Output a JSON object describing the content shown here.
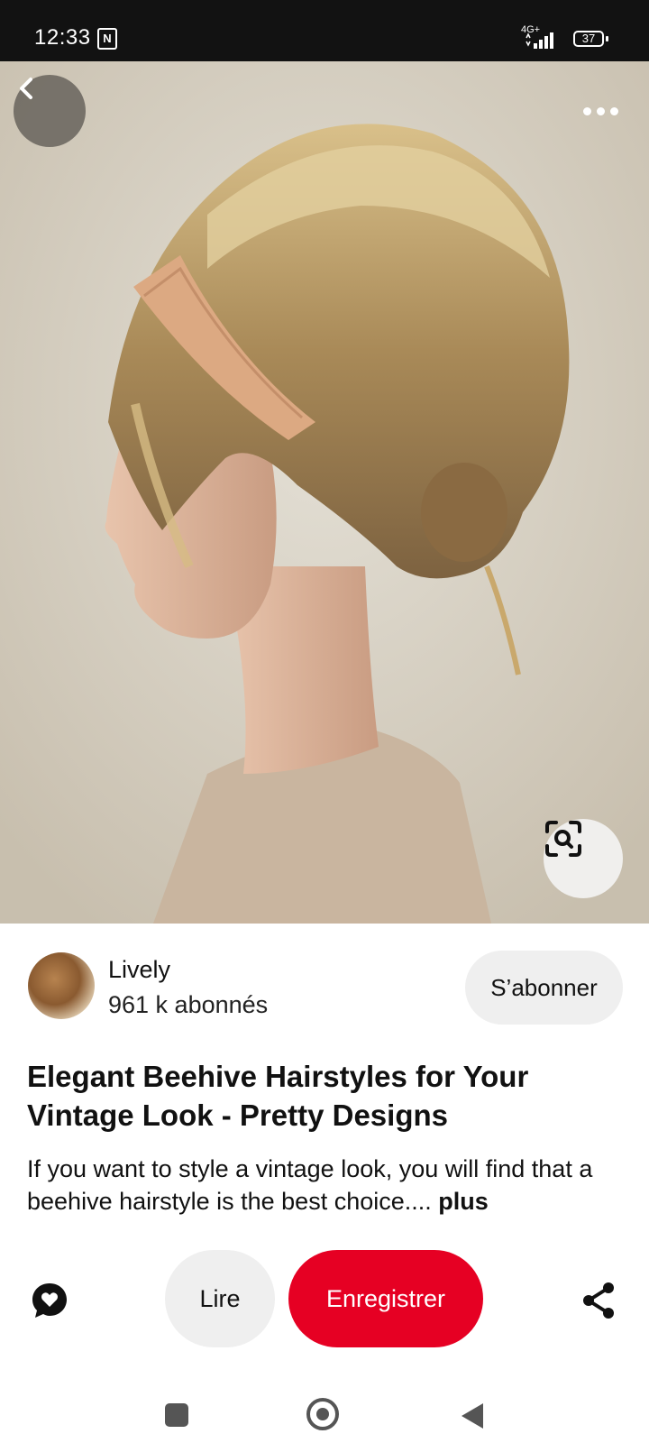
{
  "status_bar": {
    "time": "12:33",
    "nfc_label": "N",
    "network": "4G+",
    "battery": "37"
  },
  "icons": {
    "back": "chevron-left-icon",
    "more": "more-horizontal-icon",
    "visual_search": "visual-search-icon",
    "comment": "comment-icon",
    "share": "share-icon"
  },
  "creator": {
    "name": "Lively",
    "followers": "961 k abonnés",
    "follow_label": "S’abonner"
  },
  "pin": {
    "title": "Elegant Beehive Hairstyles for Your Vintage Look - Pretty Designs",
    "description": "If you want to style a vintage look, you will find that a beehive hairstyle is the best choice....",
    "more_label": "plus"
  },
  "actions": {
    "read_label": "Lire",
    "save_label": "Enregistrer"
  },
  "colors": {
    "save_red": "#e60023",
    "chip_grey": "#efefef"
  }
}
